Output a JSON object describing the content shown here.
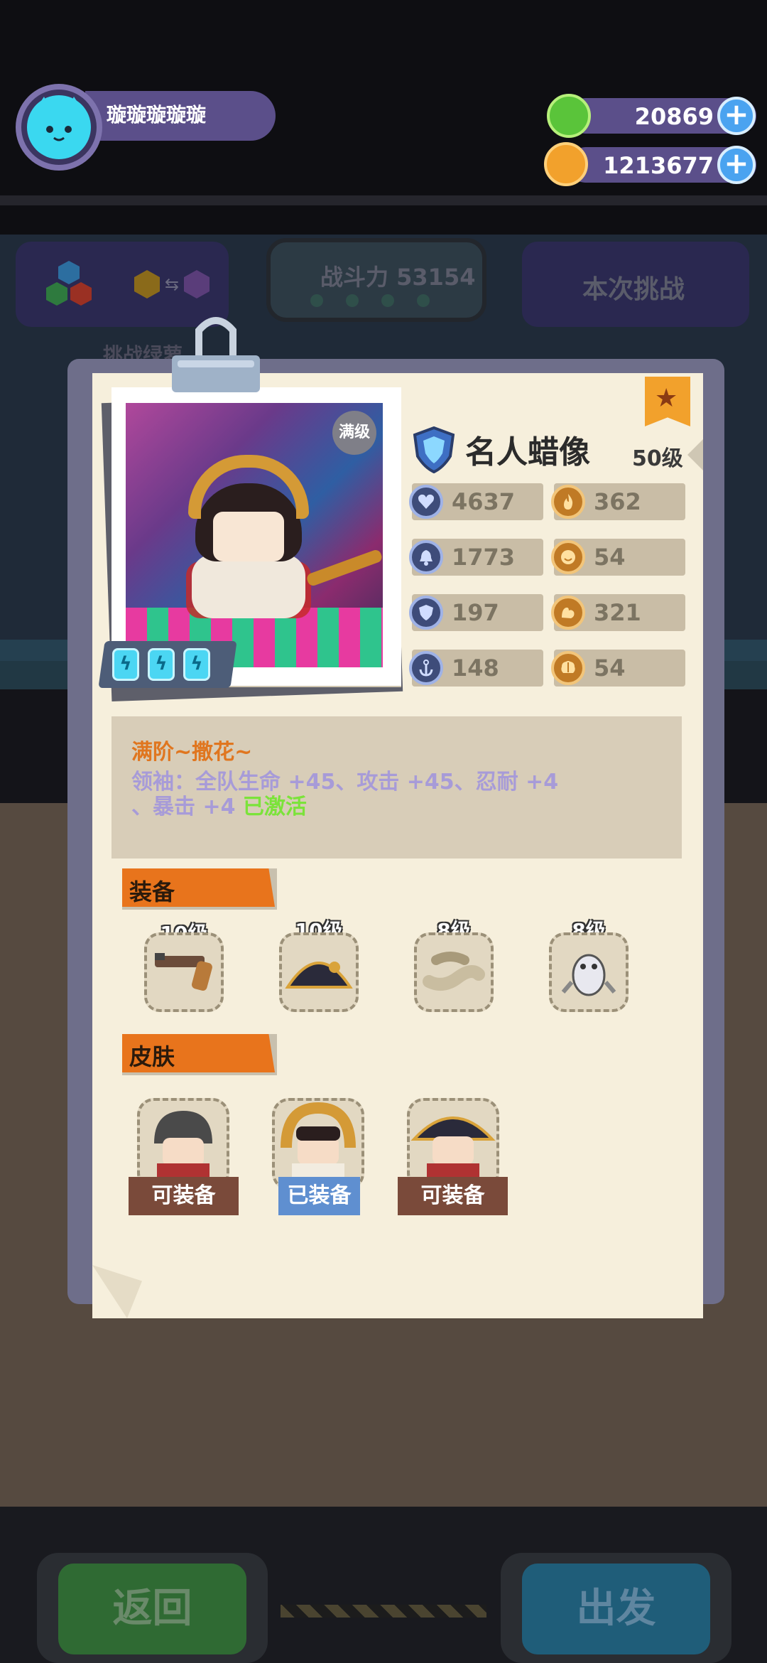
{
  "player": {
    "name": "璇璇璇璇璇"
  },
  "currencies": [
    {
      "name": "gems",
      "value": "20869",
      "icon": "green-coin-icon",
      "color": "#5ac43a"
    },
    {
      "name": "coins",
      "value": "1213677",
      "icon": "planet-coin-icon",
      "color": "#f2a12c"
    }
  ],
  "background": {
    "power_label": "战斗力 53154",
    "challenge_label": "本次挑战",
    "sub_label": "挑战绿萝"
  },
  "hero": {
    "name": "名人蜡像",
    "level": "50级",
    "max_badge": "满级",
    "stats": [
      {
        "icon": "heart-shield-icon",
        "value": "4637",
        "color": "blue"
      },
      {
        "icon": "flame-icon",
        "value": "362",
        "color": "gold"
      },
      {
        "icon": "bell-icon",
        "value": "1773",
        "color": "blue"
      },
      {
        "icon": "smile-icon",
        "value": "54",
        "color": "gold"
      },
      {
        "icon": "shield-icon",
        "value": "197",
        "color": "blue"
      },
      {
        "icon": "muscle-icon",
        "value": "321",
        "color": "gold"
      },
      {
        "icon": "anchor-icon",
        "value": "148",
        "color": "blue"
      },
      {
        "icon": "brain-icon",
        "value": "54",
        "color": "gold"
      }
    ]
  },
  "description": {
    "title": "满阶~撒花~",
    "line1": "领袖：全队生命 +45、攻击 +45、忍耐 +4",
    "line2_prefix": "、暴击 +4 ",
    "line2_active": "已激活"
  },
  "equipment": {
    "label": "装备",
    "items": [
      {
        "level": "10级",
        "icon": "pistol-icon"
      },
      {
        "level": "10级",
        "icon": "bicorne-hat-icon"
      },
      {
        "level": "8级",
        "icon": "bone-icon"
      },
      {
        "level": "8级",
        "icon": "penguin-icon"
      }
    ]
  },
  "skins": {
    "label": "皮肤",
    "items": [
      {
        "status": "可装备",
        "icon": "soldier-skin-icon",
        "state": "available"
      },
      {
        "status": "已装备",
        "icon": "laurel-skin-icon",
        "state": "equipped"
      },
      {
        "status": "可装备",
        "icon": "napoleon-skin-icon",
        "state": "available"
      }
    ]
  },
  "buttons": {
    "back": "返回",
    "go": "出发"
  }
}
